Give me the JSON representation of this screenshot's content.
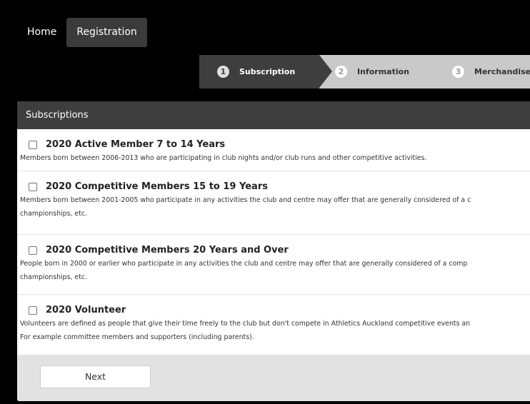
{
  "nav": {
    "home": "Home",
    "registration": "Registration"
  },
  "steps": [
    {
      "num": "1",
      "label": "Subscription"
    },
    {
      "num": "2",
      "label": "Information"
    },
    {
      "num": "3",
      "label": "Merchandise"
    }
  ],
  "panel": {
    "title": "Subscriptions",
    "items": [
      {
        "title": "2020 Active Member 7 to 14 Years",
        "desc": [
          "Members born between 2006-2013 who are participating in club nights and/or club runs and other competitive activities."
        ]
      },
      {
        "title": "2020 Competitive Members 15 to 19 Years",
        "desc": [
          "Members born between 2001-2005 who participate in any activities the club and centre may offer that are generally considered of a c",
          "championships, etc."
        ]
      },
      {
        "title": "2020 Competitive Members 20 Years and Over",
        "desc": [
          "People born in 2000 or earlier who participate in any activities the club and centre may offer that are generally considered of a comp",
          "championships, etc."
        ]
      },
      {
        "title": "2020 Volunteer",
        "desc": [
          "Volunteers are defined as people that give their time freely to the club but don't compete in Athletics Auckland competitive events an",
          "For example committee members and supporters (including parents)."
        ]
      }
    ],
    "next_label": "Next"
  }
}
